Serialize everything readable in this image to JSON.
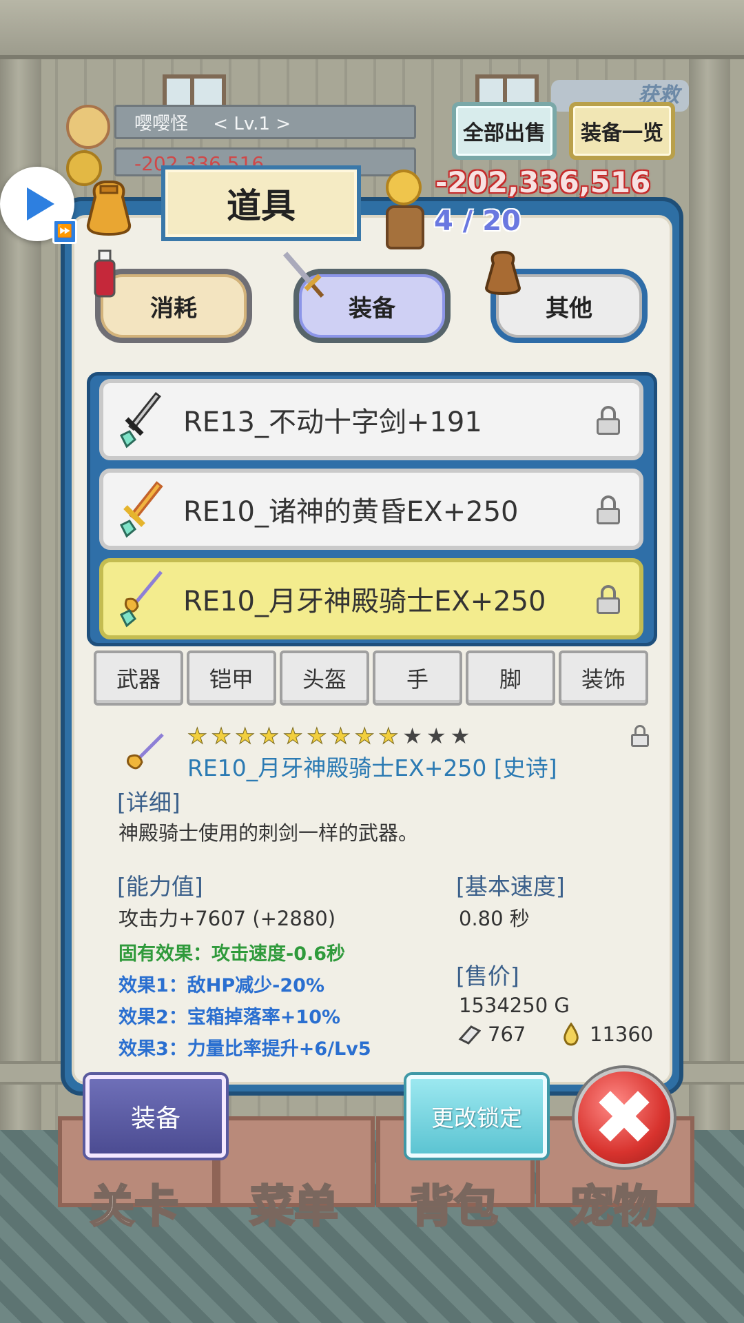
{
  "player": {
    "name": "嘤嘤怪",
    "level": "< Lv.1 >",
    "gold_small": "-202,336,516"
  },
  "header": {
    "sell_all_label": "全部出售",
    "equip_list_label": "装备一览",
    "rescue_label": "获救"
  },
  "panel": {
    "title": "道具",
    "gold": "-202,336,516",
    "capacity": "4 / 20"
  },
  "categories": [
    {
      "label": "消耗",
      "state": "normal"
    },
    {
      "label": "装备",
      "state": "selected"
    },
    {
      "label": "其他",
      "state": "normal"
    }
  ],
  "items": [
    {
      "name": "RE13_不动十字剑+191",
      "icon": "cross-sword-icon",
      "selected": false
    },
    {
      "name": "RE10_诸神的黄昏EX+250",
      "icon": "golden-sword-icon",
      "selected": false
    },
    {
      "name": "RE10_月牙神殿骑士EX+250",
      "icon": "rapier-icon",
      "selected": true
    }
  ],
  "slot_tabs": [
    "武器",
    "铠甲",
    "头盔",
    "手",
    "脚",
    "装饰"
  ],
  "detail": {
    "stars_filled": 9,
    "stars_total": 12,
    "title": "RE10_月牙神殿骑士EX+250 [史诗]",
    "section_detail": "[详细]",
    "description": "神殿骑士使用的刺剑一样的武器。",
    "section_stats": "[能力值]",
    "attack": "攻击力+7607 (+2880)",
    "inherent_effect": "固有效果：攻击速度-0.6秒",
    "effect1": "效果1：敌HP减少-20%",
    "effect2": "效果2：宝箱掉落率+10%",
    "effect3": "效果3：力量比率提升+6/Lv5",
    "section_speed": "[基本速度]",
    "speed": "0.80 秒",
    "section_price": "[售价]",
    "price": "1534250 G",
    "ingot": "767",
    "drop": "11360"
  },
  "actions": {
    "equip_label": "装备",
    "change_lock_label": "更改锁定",
    "close_glyph": "✖"
  },
  "bottom_nav": [
    "关卡",
    "菜单",
    "背包",
    "宠物"
  ],
  "colors": {
    "panel_blue": "#2e6fa4",
    "selected_row": "#f3ec8e",
    "gold_red": "#c62b2b",
    "effect_green": "#2f9a3b",
    "effect_blue": "#2a6fd0"
  }
}
